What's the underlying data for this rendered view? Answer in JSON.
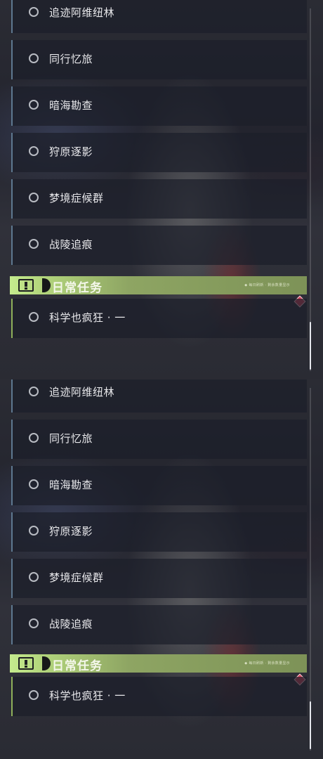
{
  "quests": [
    {
      "label": "追迹阿维纽林"
    },
    {
      "label": "同行忆旅"
    },
    {
      "label": "暗海勘查"
    },
    {
      "label": "狩原逐影"
    },
    {
      "label": "梦境症候群"
    },
    {
      "label": "战陵追痕"
    }
  ],
  "daily": {
    "title": "日常任务",
    "tiny_text": "◆ 每日刷新 · 剩余数量显示",
    "items": [
      {
        "label": "科学也疯狂 · 一"
      }
    ]
  },
  "colors": {
    "accent_green": "#b4d77d",
    "quest_border": "#5e7890",
    "alert_marker": "#d9455e"
  },
  "icons": {
    "quest_status": "circle-outline-icon",
    "section": "exclamation-box-icon",
    "alert": "red-diamond-icon"
  }
}
